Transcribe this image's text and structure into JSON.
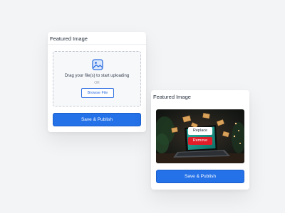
{
  "upload_card": {
    "title": "Featured Image",
    "drag_text": "Drag your file(s) to start uploading",
    "or_text": "OR",
    "browse_label": "Browse File",
    "publish_label": "Save & Publish",
    "icon": "image-upload-icon"
  },
  "preview_card": {
    "title": "Featured Image",
    "replace_label": "Replace",
    "remove_label": "Remove",
    "publish_label": "Save & Publish",
    "image": "laptop-with-envelopes-image"
  },
  "colors": {
    "background": "#f3f4f6",
    "accent": "#2471e8",
    "danger": "#e11d2a",
    "card": "#ffffff"
  }
}
